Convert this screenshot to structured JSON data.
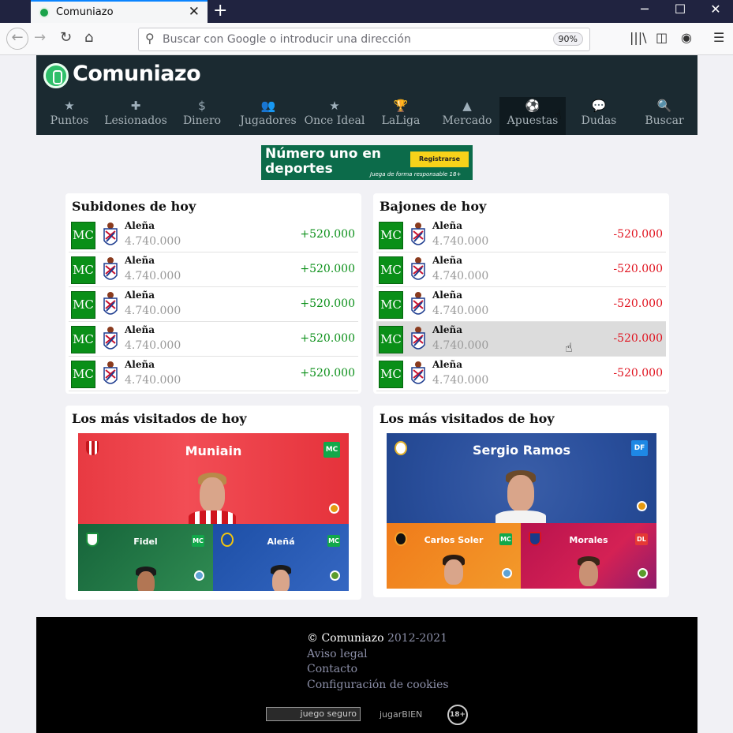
{
  "browser": {
    "tab_title": "Comuniazo",
    "tab_close": "✕",
    "new_tab": "+",
    "url_placeholder": "Buscar con Google o introducir una dirección",
    "zoom": "90%",
    "window_min": "─",
    "window_max": "☐",
    "window_close": "✕"
  },
  "site": {
    "logo_text": "Comuniazo",
    "menu": [
      {
        "label": "Puntos",
        "icon": "★"
      },
      {
        "label": "Lesionados",
        "icon": "✚"
      },
      {
        "label": "Dinero",
        "icon": "$"
      },
      {
        "label": "Jugadores",
        "icon": "👥"
      },
      {
        "label": "Once Ideal",
        "icon": "★"
      },
      {
        "label": "LaLiga",
        "icon": "🏆"
      },
      {
        "label": "Mercado",
        "icon": "▲"
      },
      {
        "label": "Apuestas",
        "icon": "⚽"
      },
      {
        "label": "Dudas",
        "icon": "💬"
      },
      {
        "label": "Buscar",
        "icon": "🔍"
      }
    ],
    "active_menu": "Apuestas"
  },
  "banner": {
    "text": "Número uno en deportes",
    "button": "Registrarse",
    "small": "Juega de forma responsable 18+"
  },
  "risers": {
    "title": "Subidones de hoy",
    "rows": [
      {
        "pos": "MC",
        "name": "Aleña",
        "value": "4.740.000",
        "delta": "+520.000"
      },
      {
        "pos": "MC",
        "name": "Aleña",
        "value": "4.740.000",
        "delta": "+520.000"
      },
      {
        "pos": "MC",
        "name": "Aleña",
        "value": "4.740.000",
        "delta": "+520.000"
      },
      {
        "pos": "MC",
        "name": "Aleña",
        "value": "4.740.000",
        "delta": "+520.000"
      },
      {
        "pos": "MC",
        "name": "Aleña",
        "value": "4.740.000",
        "delta": "+520.000"
      }
    ]
  },
  "fallers": {
    "title": "Bajones de hoy",
    "rows": [
      {
        "pos": "MC",
        "name": "Aleña",
        "value": "4.740.000",
        "delta": "-520.000"
      },
      {
        "pos": "MC",
        "name": "Aleña",
        "value": "4.740.000",
        "delta": "-520.000"
      },
      {
        "pos": "MC",
        "name": "Aleña",
        "value": "4.740.000",
        "delta": "-520.000"
      },
      {
        "pos": "MC",
        "name": "Aleña",
        "value": "4.740.000",
        "delta": "-520.000"
      },
      {
        "pos": "MC",
        "name": "Aleña",
        "value": "4.740.000",
        "delta": "-520.000"
      }
    ]
  },
  "visited_left": {
    "title": "Los más visitados de hoy",
    "main": {
      "name": "Muniain",
      "pos": "MC"
    },
    "sub": [
      {
        "name": "Fidel",
        "pos": "MC"
      },
      {
        "name": "Aleñá",
        "pos": "MC"
      }
    ]
  },
  "visited_right": {
    "title": "Los más visitados de hoy",
    "main": {
      "name": "Sergio Ramos",
      "pos": "DF"
    },
    "sub": [
      {
        "name": "Carlos Soler",
        "pos": "MC"
      },
      {
        "name": "Morales",
        "pos": "DL"
      }
    ]
  },
  "footer": {
    "copyright": "© Comuniazo",
    "years": "2012-2021",
    "links": [
      "Aviso legal",
      "Contacto",
      "Configuración de cookies"
    ],
    "badges": [
      "juego seguro",
      "jugarBIEN",
      "18+"
    ]
  },
  "colors": {
    "header_bg": "#1b2a31",
    "position_green": "#0a8f18",
    "rise_green": "#0a8f18",
    "fall_red": "#e0121e"
  }
}
